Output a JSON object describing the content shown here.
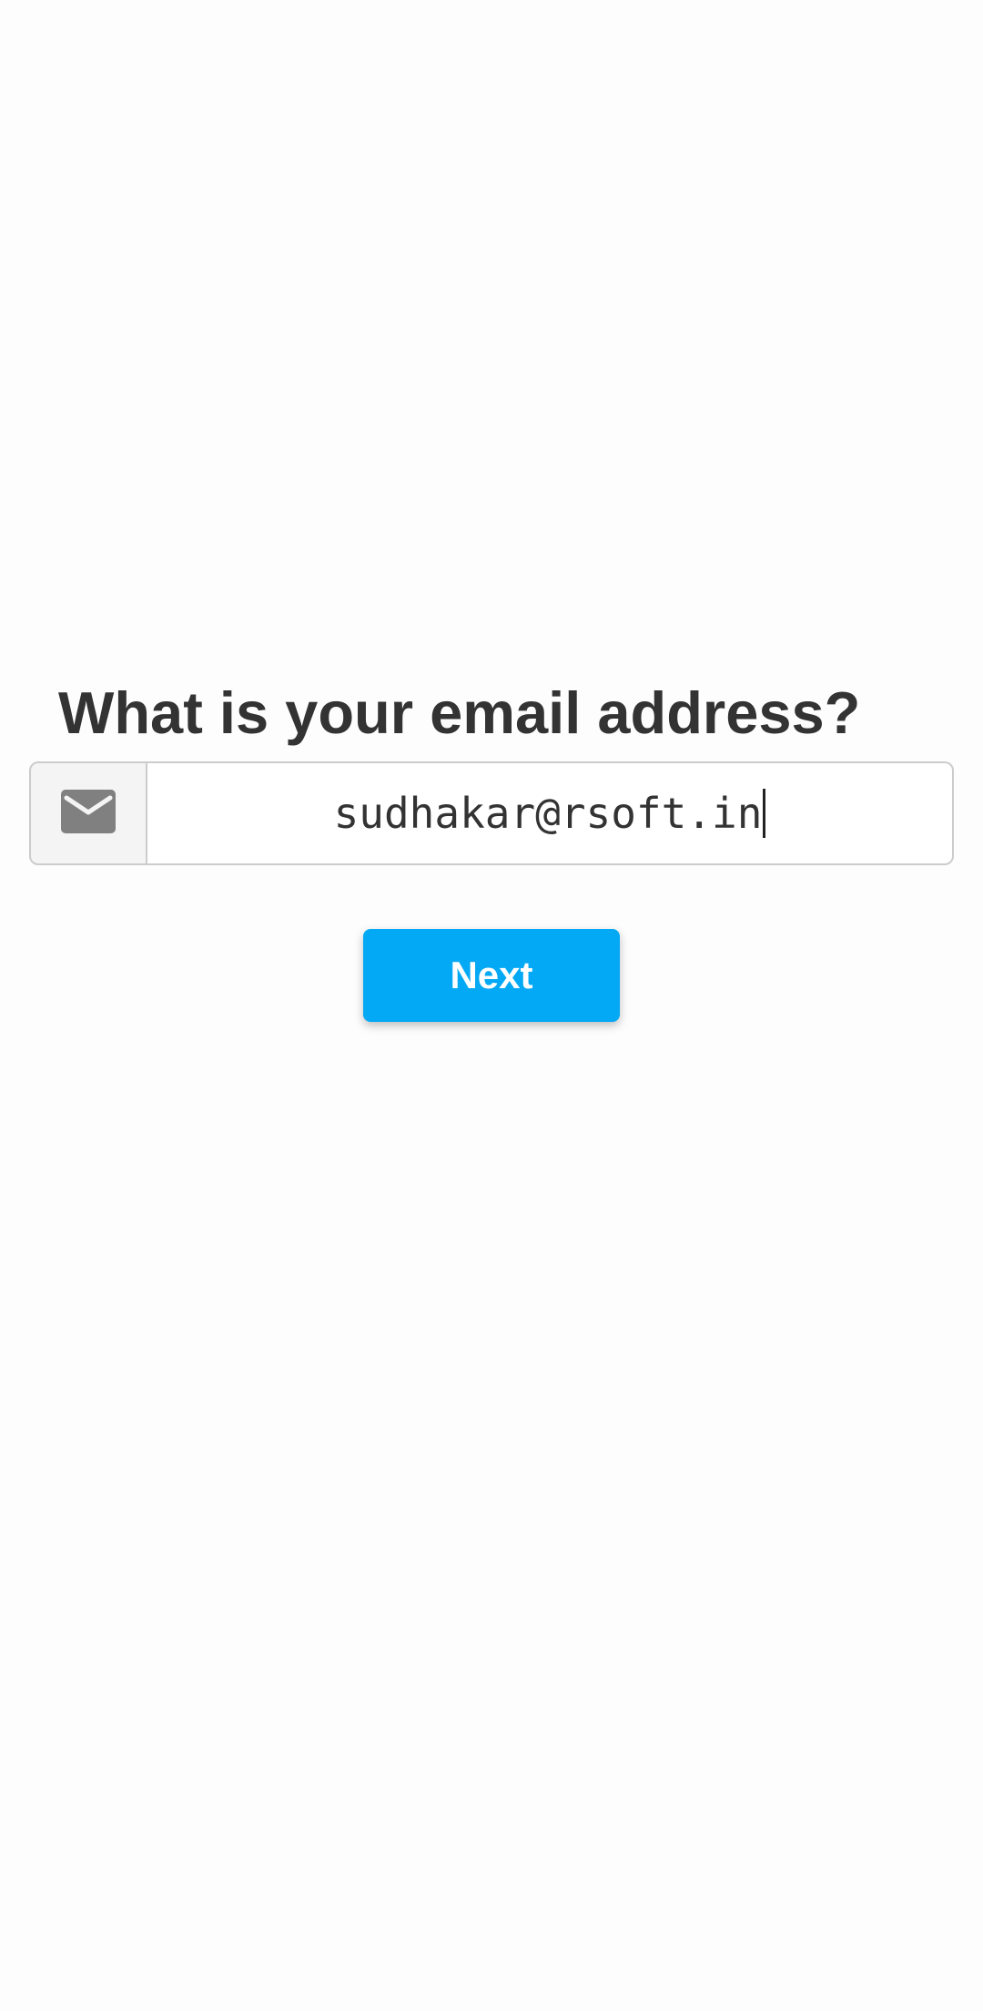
{
  "question": {
    "text": "What is your email address?"
  },
  "email_input": {
    "value": "sudhakar@rsoft.in",
    "icon": "envelope-icon"
  },
  "actions": {
    "next_label": "Next"
  },
  "colors": {
    "accent": "#03a9f4",
    "text": "#333333",
    "background": "#fdfdfd"
  }
}
